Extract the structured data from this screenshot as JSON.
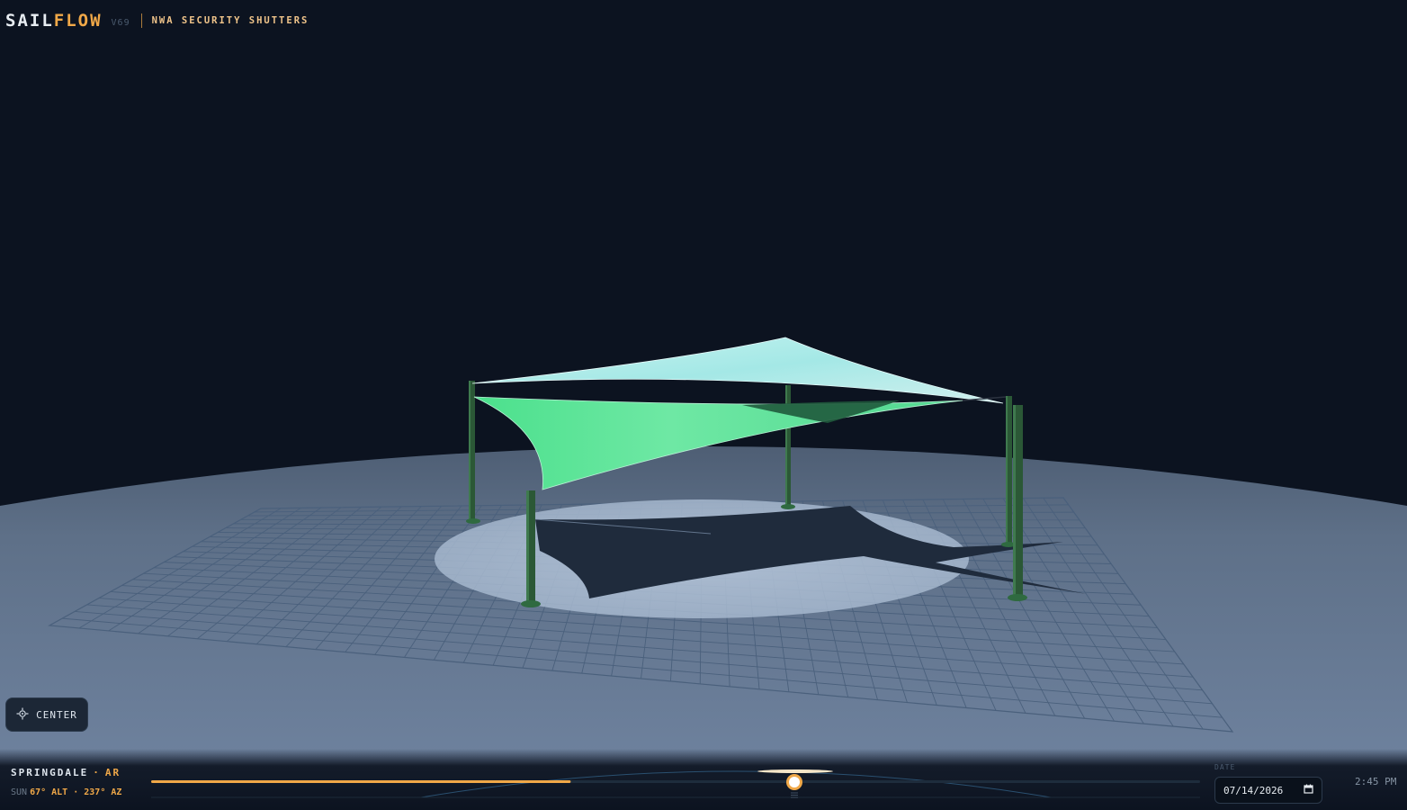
{
  "brand": {
    "name_part1": "SAIL",
    "name_part2": "FLOW",
    "version": "V69",
    "client": "NWA SECURITY SHUTTERS"
  },
  "controls": {
    "center_label": "CENTER"
  },
  "location": {
    "city": "SPRINGDALE",
    "separator": "·",
    "state": "AR"
  },
  "sun": {
    "label": "SUN",
    "value": "67° ALT · 237° AZ"
  },
  "timeline": {
    "progress_fraction": 0.4
  },
  "date": {
    "label": "DATE",
    "value": "07/14/2026"
  },
  "time": {
    "value": "2:45 PM"
  },
  "colors": {
    "accent": "#f0a848",
    "background": "#0c1320",
    "ground": "#6b809c",
    "sail_upper": "#9ce8e4",
    "sail_lower": "#4fe08e",
    "post": "#2c5c38"
  }
}
